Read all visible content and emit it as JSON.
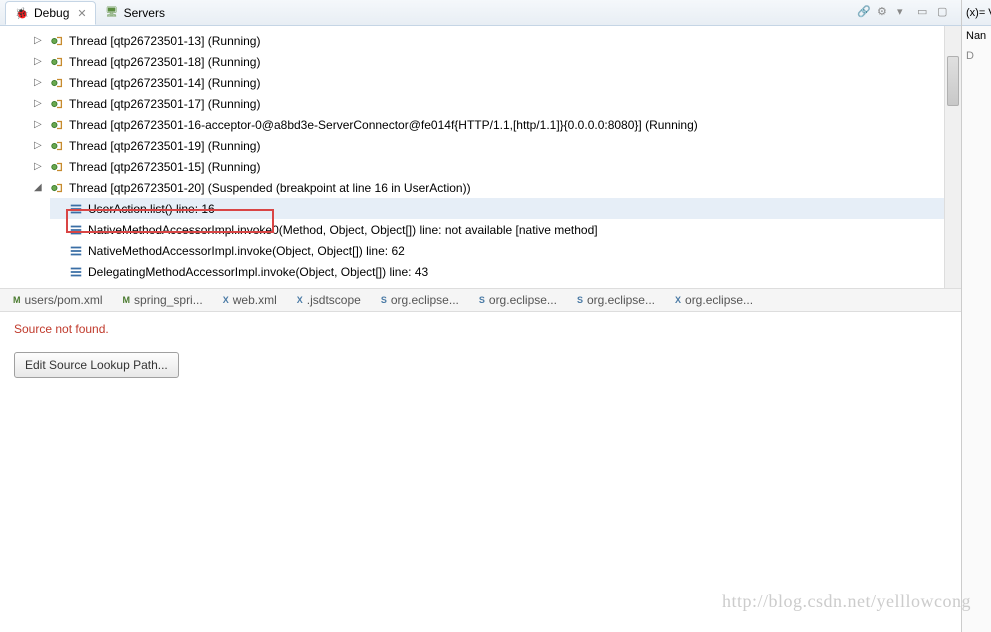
{
  "tabs": {
    "debug": "Debug",
    "servers": "Servers"
  },
  "right_panel": {
    "tab": "(x)= V",
    "header": "Nan",
    "subheader": "D"
  },
  "threads": [
    {
      "label": "Thread [qtp26723501-13] (Running)",
      "type": "thread",
      "level": 0
    },
    {
      "label": "Thread [qtp26723501-18] (Running)",
      "type": "thread",
      "level": 0
    },
    {
      "label": "Thread [qtp26723501-14] (Running)",
      "type": "thread",
      "level": 0
    },
    {
      "label": "Thread [qtp26723501-17] (Running)",
      "type": "thread",
      "level": 0
    },
    {
      "label": "Thread [qtp26723501-16-acceptor-0@a8bd3e-ServerConnector@fe014f{HTTP/1.1,[http/1.1]}{0.0.0.0:8080}] (Running)",
      "type": "thread",
      "level": 0
    },
    {
      "label": "Thread [qtp26723501-19] (Running)",
      "type": "thread",
      "level": 0
    },
    {
      "label": "Thread [qtp26723501-15] (Running)",
      "type": "thread",
      "level": 0
    },
    {
      "label": "Thread [qtp26723501-20] (Suspended (breakpoint at line 16 in UserAction))",
      "type": "thread",
      "level": 0,
      "expanded": true
    },
    {
      "label": "UserAction.list() line: 16",
      "type": "stack",
      "level": 1,
      "selected": true
    },
    {
      "label": "NativeMethodAccessorImpl.invoke0(Method, Object, Object[]) line: not available [native method]",
      "type": "stack",
      "level": 1
    },
    {
      "label": "NativeMethodAccessorImpl.invoke(Object, Object[]) line: 62",
      "type": "stack",
      "level": 1
    },
    {
      "label": "DelegatingMethodAccessorImpl.invoke(Object, Object[]) line: 43",
      "type": "stack",
      "level": 1
    }
  ],
  "editor_tabs": [
    {
      "label": "users/pom.xml",
      "icon": "m"
    },
    {
      "label": "spring_spri...",
      "icon": "m"
    },
    {
      "label": "web.xml",
      "icon": "x"
    },
    {
      "label": ".jsdtscope",
      "icon": "x"
    },
    {
      "label": "org.eclipse...",
      "icon": "s"
    },
    {
      "label": "org.eclipse...",
      "icon": "s"
    },
    {
      "label": "org.eclipse...",
      "icon": "s"
    },
    {
      "label": "org.eclipse...",
      "icon": "x"
    }
  ],
  "editor": {
    "error": "Source not found.",
    "button": "Edit Source Lookup Path..."
  },
  "watermark": "http://blog.csdn.net/yelllowcong"
}
